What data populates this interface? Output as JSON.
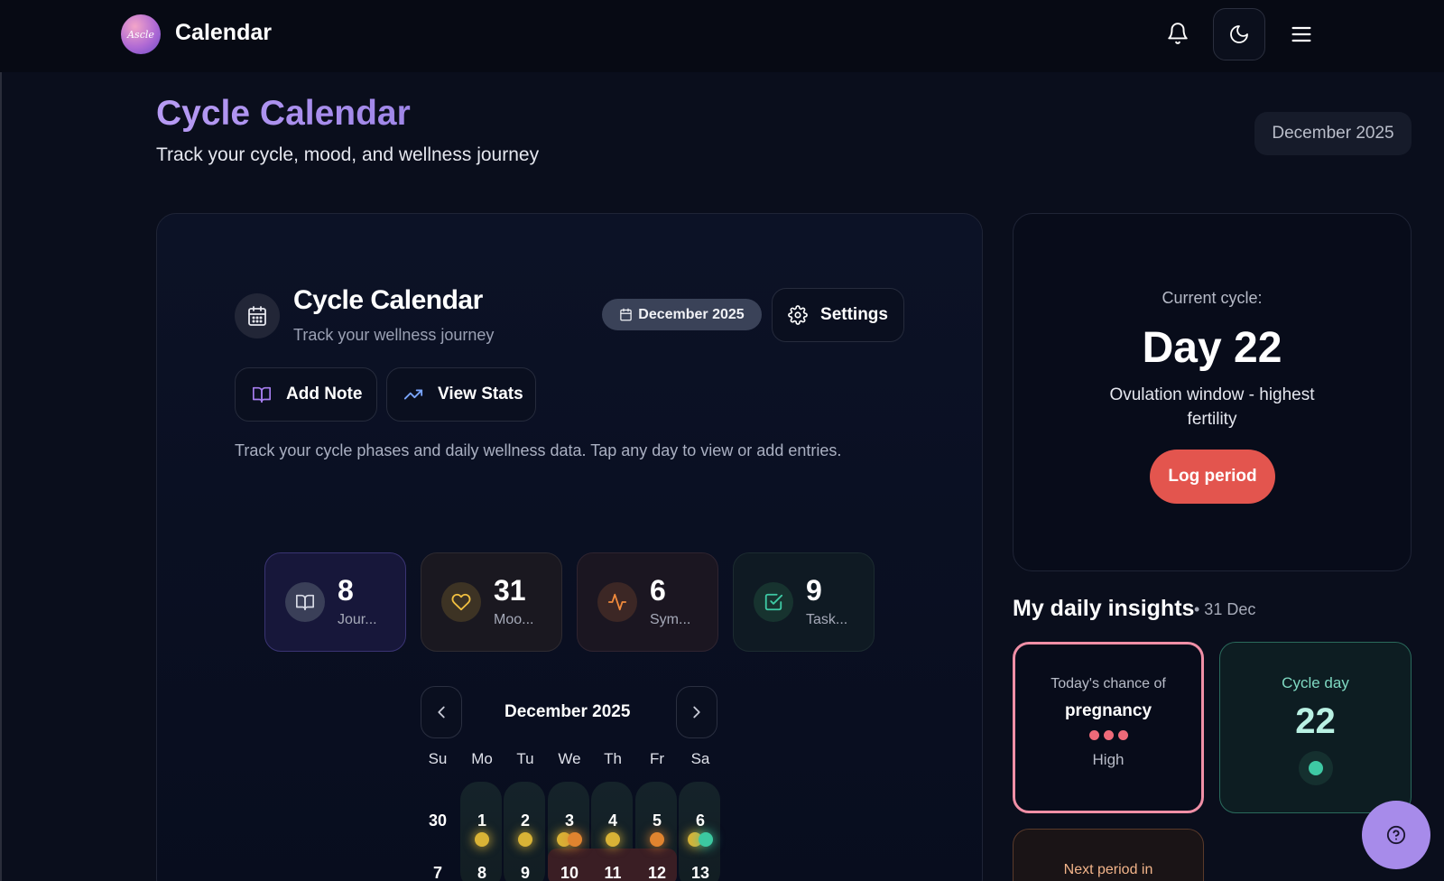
{
  "topbar": {
    "logo_text": "Ascle",
    "app_title": "Calendar"
  },
  "header": {
    "title": "Cycle Calendar",
    "subtitle": "Track your cycle, mood, and wellness journey",
    "month_pill": "December 2025"
  },
  "card": {
    "title": "Cycle Calendar",
    "subtitle": "Track your wellness journey",
    "month_badge": "December 2025",
    "settings_label": "Settings",
    "add_note_label": "Add Note",
    "view_stats_label": "View Stats",
    "description": "Track your cycle phases and daily wellness data. Tap any day to view or add entries."
  },
  "stats": [
    {
      "value": "8",
      "label": "Jour..."
    },
    {
      "value": "31",
      "label": "Moo..."
    },
    {
      "value": "6",
      "label": "Sym..."
    },
    {
      "value": "9",
      "label": "Task..."
    }
  ],
  "calendar": {
    "month_label": "December 2025",
    "weekdays": [
      "Su",
      "Mo",
      "Tu",
      "We",
      "Th",
      "Fr",
      "Sa"
    ],
    "row1": [
      "30",
      "1",
      "2",
      "3",
      "4",
      "5",
      "6"
    ],
    "row2": [
      "7",
      "8",
      "9",
      "10",
      "11",
      "12",
      "13"
    ]
  },
  "cycle": {
    "label": "Current cycle:",
    "day": "Day 22",
    "description": "Ovulation window - highest fertility",
    "log_button": "Log period"
  },
  "insights": {
    "title": "My daily insights",
    "date": "• 31 Dec",
    "pregnancy": {
      "line1": "Today's chance of",
      "line2": "pregnancy",
      "level": "High"
    },
    "cycle_day": {
      "label": "Cycle day",
      "value": "22"
    },
    "next_period": {
      "label": "Next period in"
    }
  },
  "colors": {
    "accent_purple": "#a78bea",
    "log_red": "#e3554e",
    "teal": "#3ec9a4",
    "pink_border": "#f08fa6"
  }
}
